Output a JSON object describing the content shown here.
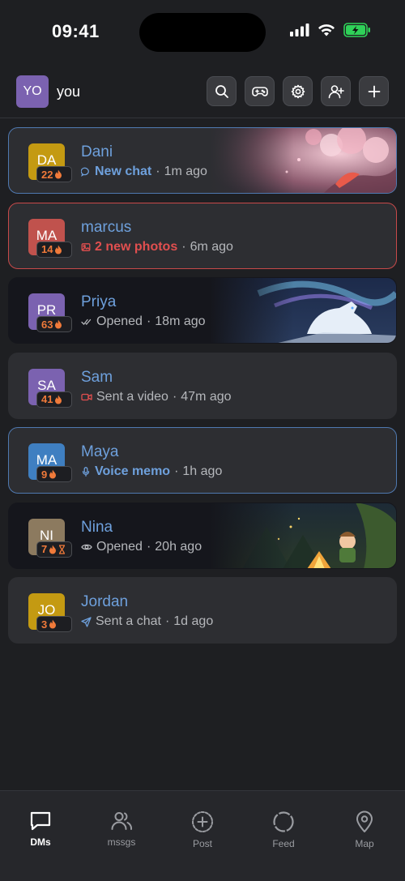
{
  "status": {
    "time": "09:41"
  },
  "header": {
    "avatar_initials": "YO",
    "username": "you"
  },
  "header_buttons": [
    "search-icon",
    "gamepad-icon",
    "gear-icon",
    "add-friend-icon",
    "plus-icon"
  ],
  "chats": [
    {
      "initials": "DA",
      "name": "Dani",
      "streak": "22",
      "hourglass": false,
      "status_icon": "chat-bubble-icon",
      "status": "New chat",
      "status_style": "blue",
      "ago": "1m ago",
      "avatar_color": "#c49a12",
      "border": "blue",
      "art": "cherry-blossom-art"
    },
    {
      "initials": "MA",
      "name": "marcus",
      "streak": "14",
      "hourglass": false,
      "status_icon": "photo-icon",
      "status": "2 new photos",
      "status_style": "red",
      "ago": "6m ago",
      "avatar_color": "#c0524d",
      "border": "red",
      "art": ""
    },
    {
      "initials": "PR",
      "name": "Priya",
      "streak": "63",
      "hourglass": false,
      "status_icon": "double-check-icon",
      "status": "Opened",
      "status_style": "grey",
      "ago": "18m ago",
      "avatar_color": "#7b62b0",
      "border": "none",
      "art": "wolf-aurora-art"
    },
    {
      "initials": "SA",
      "name": "Sam",
      "streak": "41",
      "hourglass": false,
      "status_icon": "video-icon",
      "status": "Sent a video",
      "status_style": "grey",
      "ago": "47m ago",
      "avatar_color": "#7b62b0",
      "border": "none",
      "art": ""
    },
    {
      "initials": "MA",
      "name": "Maya",
      "streak": "9",
      "hourglass": false,
      "status_icon": "microphone-icon",
      "status": "Voice memo",
      "status_style": "blue",
      "ago": "1h ago",
      "avatar_color": "#3f7fc1",
      "border": "blue",
      "art": ""
    },
    {
      "initials": "NI",
      "name": "Nina",
      "streak": "7",
      "hourglass": true,
      "status_icon": "eye-icon",
      "status": "Opened",
      "status_style": "grey",
      "ago": "20h ago",
      "avatar_color": "#8c7a5f",
      "border": "none",
      "art": "campfire-art"
    },
    {
      "initials": "JO",
      "name": "Jordan",
      "streak": "3",
      "hourglass": false,
      "status_icon": "send-icon",
      "status": "Sent a chat",
      "status_style": "grey",
      "ago": "1d ago",
      "avatar_color": "#c49a12",
      "border": "none",
      "art": ""
    }
  ],
  "tabs": [
    {
      "label": "DMs",
      "icon": "chat-bubble-icon",
      "active": true
    },
    {
      "label": "mssgs",
      "icon": "people-icon",
      "active": false
    },
    {
      "label": "Post",
      "icon": "plus-circle-icon",
      "active": false
    },
    {
      "label": "Feed",
      "icon": "circle-icon",
      "active": false
    },
    {
      "label": "Map",
      "icon": "map-pin-icon",
      "active": false
    }
  ],
  "colors": {
    "accent": "#6ea0dc",
    "alert": "#e14f4f",
    "streak": "#f07a3a",
    "background": "#1e1f22",
    "card": "#2d2e32"
  }
}
